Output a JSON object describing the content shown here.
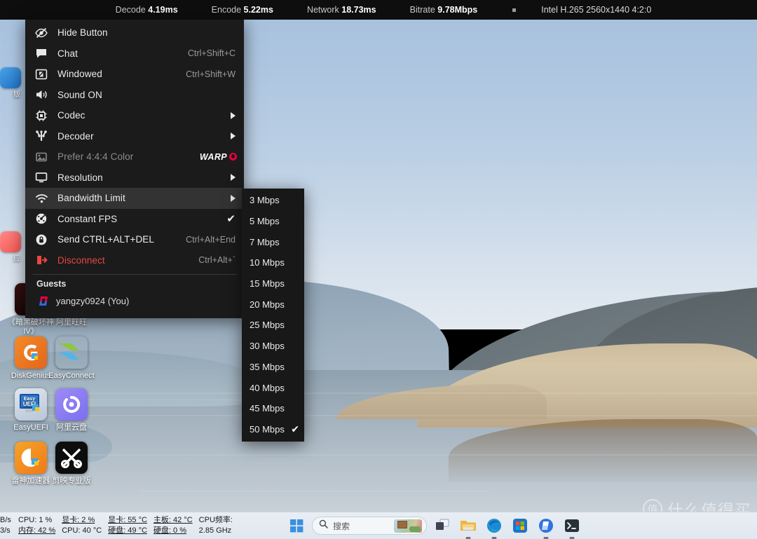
{
  "topbar": {
    "stats": [
      {
        "label": "Decode",
        "value": "4.19ms"
      },
      {
        "label": "Encode",
        "value": "5.22ms"
      },
      {
        "label": "Network",
        "value": "18.73ms"
      },
      {
        "label": "Bitrate",
        "value": "9.78Mbps"
      }
    ],
    "separator_icon": "square-dot-icon",
    "codec_info": "Intel H.265 2560x1440 4:2:0"
  },
  "context_menu": {
    "items": [
      {
        "icon": "eye-slash-icon",
        "label": "Hide Button",
        "accel": "",
        "type": "normal"
      },
      {
        "icon": "chat-bubble-icon",
        "label": "Chat",
        "accel": "Ctrl+Shift+C",
        "type": "normal"
      },
      {
        "icon": "windowed-icon",
        "label": "Windowed",
        "accel": "Ctrl+Shift+W",
        "type": "normal"
      },
      {
        "icon": "speaker-on-icon",
        "label": "Sound ON",
        "accel": "",
        "type": "normal"
      },
      {
        "icon": "chip-icon",
        "label": "Codec",
        "accel": "",
        "type": "submenu"
      },
      {
        "icon": "decoder-icon",
        "label": "Decoder",
        "accel": "",
        "type": "submenu"
      },
      {
        "icon": "image-icon",
        "label": "Prefer 4:4:4 Color",
        "accel": "",
        "type": "disabled",
        "badge": "WARP"
      },
      {
        "icon": "monitor-icon",
        "label": "Resolution",
        "accel": "",
        "type": "submenu"
      },
      {
        "icon": "wifi-icon",
        "label": "Bandwidth Limit",
        "accel": "",
        "type": "submenu",
        "highlighted": true
      },
      {
        "icon": "speedometer-icon",
        "label": "Constant FPS",
        "accel": "",
        "type": "checked"
      },
      {
        "icon": "lock-icon",
        "label": "Send CTRL+ALT+DEL",
        "accel": "Ctrl+Alt+End",
        "type": "normal"
      },
      {
        "icon": "disconnect-icon",
        "label": "Disconnect",
        "accel": "Ctrl+Alt+`",
        "type": "danger"
      }
    ],
    "guests_header": "Guests",
    "guests": [
      {
        "icon": "parsec-logo-icon",
        "name": "yangzy0924 (You)"
      }
    ]
  },
  "submenu": {
    "title": "Bandwidth Limit",
    "options": [
      {
        "label": "3 Mbps",
        "checked": false
      },
      {
        "label": "5 Mbps",
        "checked": false
      },
      {
        "label": "7 Mbps",
        "checked": false
      },
      {
        "label": "10 Mbps",
        "checked": false
      },
      {
        "label": "15 Mbps",
        "checked": false
      },
      {
        "label": "20 Mbps",
        "checked": false
      },
      {
        "label": "25 Mbps",
        "checked": false
      },
      {
        "label": "30 Mbps",
        "checked": false
      },
      {
        "label": "35 Mbps",
        "checked": false
      },
      {
        "label": "40 Mbps",
        "checked": false
      },
      {
        "label": "45 Mbps",
        "checked": false
      },
      {
        "label": "50 Mbps",
        "checked": true
      }
    ],
    "checkmark": "✔"
  },
  "desktop_icons": [
    {
      "id": "diablo",
      "label": "《暗黑破坏神 IV》",
      "icon": "diablo-icon"
    },
    {
      "id": "wangwang",
      "label": "阿里旺旺",
      "icon": "aliwangwang-icon"
    },
    {
      "id": "diskgenius",
      "label": "DiskGenius",
      "icon": "diskgenius-icon"
    },
    {
      "id": "easyconnect",
      "label": "EasyConnect",
      "icon": "easyconnect-icon"
    },
    {
      "id": "easyuefi",
      "label": "EasyUEFI",
      "icon": "easyuefi-icon"
    },
    {
      "id": "aliyunpan",
      "label": "阿里云盘",
      "icon": "aliyunpan-icon"
    },
    {
      "id": "leishen",
      "label": "雷神加速器",
      "icon": "leishen-icon"
    },
    {
      "id": "jianying",
      "label": "剪映专业版",
      "icon": "jianying-icon"
    }
  ],
  "edge_icons": [
    {
      "id": "edge-1",
      "label": "版"
    },
    {
      "id": "edge-2",
      "label": "应"
    }
  ],
  "taskbar": {
    "sysmon": {
      "net_up": "B/s",
      "net_down": "3/s",
      "groups": [
        {
          "top": "CPU: 1 %",
          "bottom": "内存: 42 %"
        },
        {
          "top": "显卡: 2 %",
          "bottom": "CPU: 40 °C"
        },
        {
          "top": "显卡: 55 °C",
          "bottom": "硬盘: 49 °C"
        },
        {
          "top": "主板: 42 °C",
          "bottom": "硬盘: 0 %"
        },
        {
          "top": "CPU频率:",
          "bottom": "2.85 GHz"
        }
      ]
    },
    "start_button": "start-button",
    "search": {
      "placeholder": "搜索",
      "icon": "search-icon",
      "thumbnail": "bing-wallpaper-thumb"
    },
    "pinned": [
      {
        "id": "taskview",
        "icon": "task-view-icon",
        "running": false
      },
      {
        "id": "fileexplorer",
        "icon": "folder-icon",
        "running": true
      },
      {
        "id": "edge",
        "icon": "edge-browser-icon",
        "running": true
      },
      {
        "id": "store",
        "icon": "microsoft-store-icon",
        "running": false
      },
      {
        "id": "parsec",
        "icon": "parsec-icon",
        "running": true
      },
      {
        "id": "terminal",
        "icon": "terminal-icon",
        "running": true
      }
    ]
  },
  "watermark": {
    "mark": "值",
    "text": "什么值得买"
  },
  "colors": {
    "menu_bg": "#1b1b1b",
    "submenu_bg": "#181818",
    "menu_highlight": "#333333",
    "danger": "#e8473f",
    "warp_red": "#e6003c",
    "topbar_bg": "#0e0e0e",
    "taskbar_bg": "#e4ebf3"
  }
}
